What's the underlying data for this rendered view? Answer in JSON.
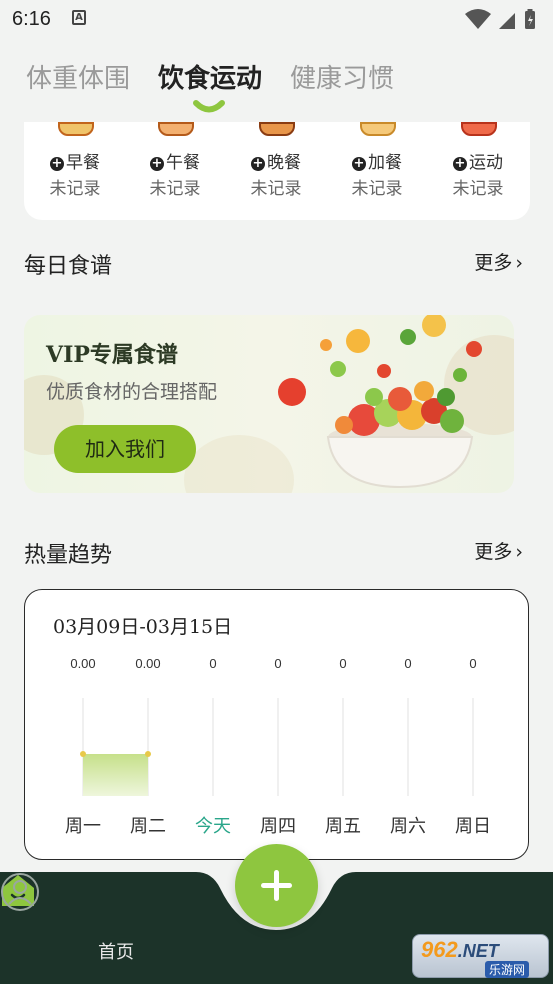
{
  "status_bar": {
    "time": "6:16",
    "notification_glyph": "A"
  },
  "tabs": [
    {
      "label": "体重体围"
    },
    {
      "label": "饮食运动"
    },
    {
      "label": "健康习惯"
    }
  ],
  "meals": [
    {
      "label": "早餐",
      "status": "未记录",
      "icon": "breakfast-icon"
    },
    {
      "label": "午餐",
      "status": "未记录",
      "icon": "lunch-icon"
    },
    {
      "label": "晚餐",
      "status": "未记录",
      "icon": "dinner-icon"
    },
    {
      "label": "加餐",
      "status": "未记录",
      "icon": "snack-icon"
    },
    {
      "label": "运动",
      "status": "未记录",
      "icon": "exercise-icon"
    }
  ],
  "recipes_section": {
    "title": "每日食谱",
    "more": "更多"
  },
  "vip_banner": {
    "title": "VIP专属食谱",
    "subtitle": "优质食材的合理搭配",
    "button": "加入我们"
  },
  "trend_section": {
    "title": "热量趋势",
    "more": "更多"
  },
  "trend_card": {
    "date_range": "03月09日-03月15日"
  },
  "chart_data": {
    "type": "area",
    "categories": [
      "周一",
      "周二",
      "今天",
      "周四",
      "周五",
      "周六",
      "周日"
    ],
    "value_labels": [
      "0.00",
      "0.00",
      "0",
      "0",
      "0",
      "0",
      "0"
    ],
    "values": [
      0,
      0,
      0,
      0,
      0,
      0,
      0
    ],
    "highlight_index": 2,
    "grid": true,
    "colors": {
      "fill": "#c6e08a",
      "point": "#e8c94a",
      "highlight_label": "#2aa68a"
    }
  },
  "bottom_nav": {
    "home_label": "首页"
  },
  "watermark": {
    "top": "962",
    "net": ".NET",
    "bottom": "乐游网"
  },
  "colors": {
    "accent": "#8ec63f",
    "nav_bg": "#1c3329"
  }
}
